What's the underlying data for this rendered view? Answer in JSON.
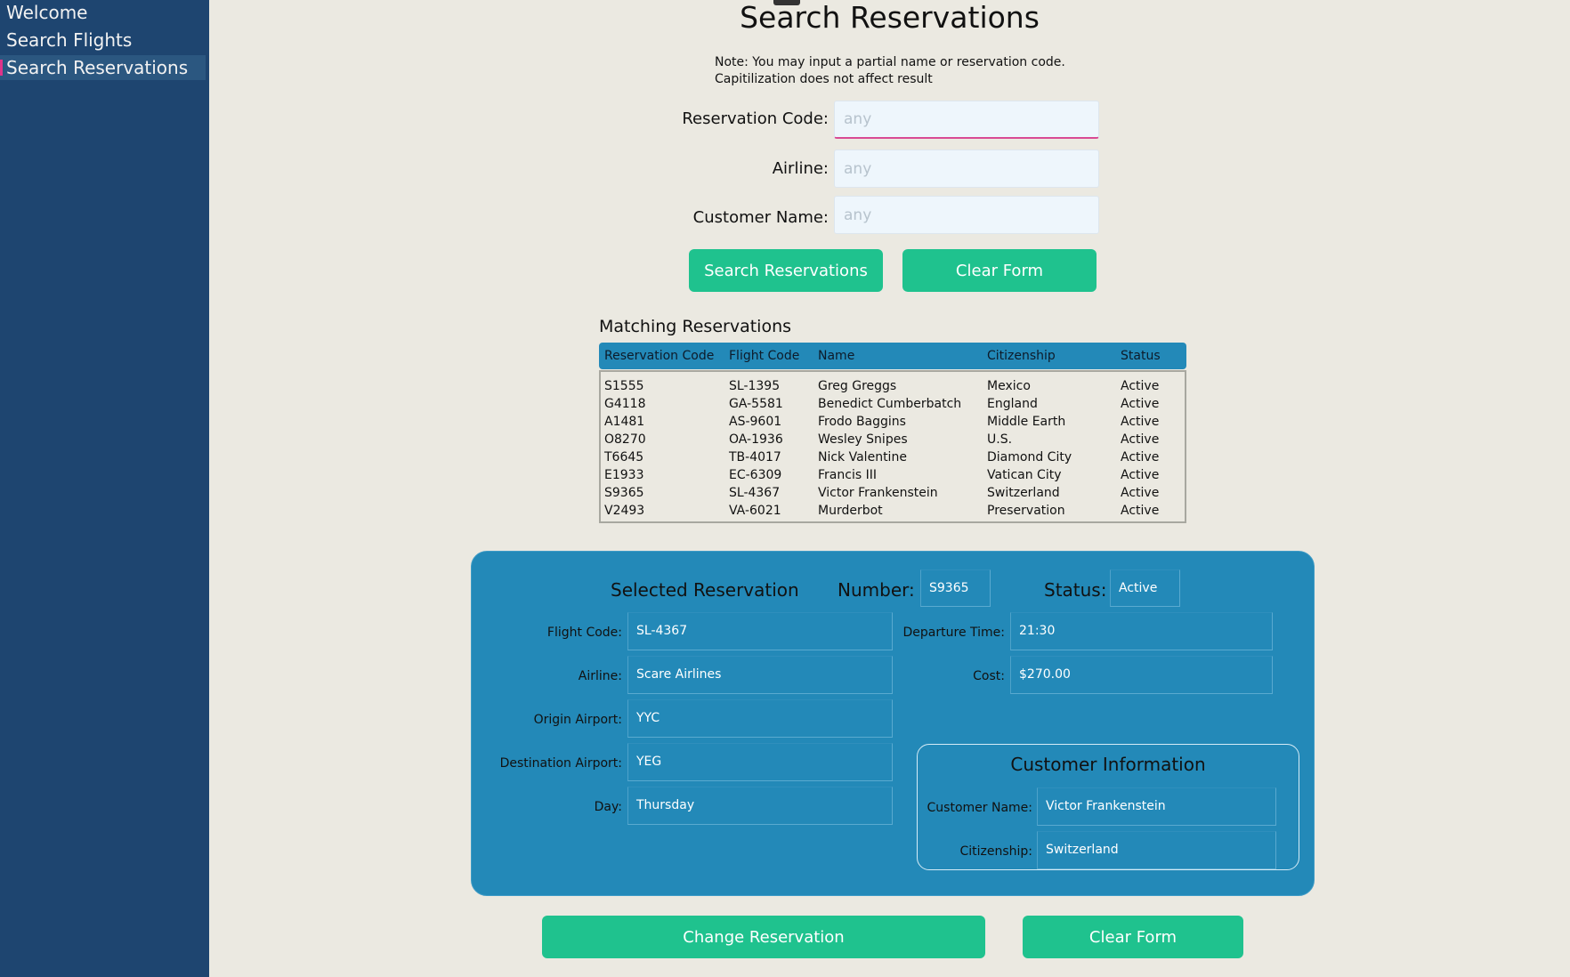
{
  "sidebar": {
    "items": [
      {
        "label": "Welcome"
      },
      {
        "label": "Search Flights"
      },
      {
        "label": "Search Reservations"
      }
    ]
  },
  "page": {
    "title": "Search Reservations",
    "note_line1": "Note: You may input a partial name or reservation code.",
    "note_line2": "Capitilization does not affect result"
  },
  "search_form": {
    "reservation_code_label": "Reservation Code:",
    "airline_label": "Airline:",
    "customer_name_label": "Customer Name:",
    "placeholder": "any",
    "search_button": "Search Reservations",
    "clear_button": "Clear Form"
  },
  "results": {
    "title": "Matching Reservations",
    "columns": [
      "Reservation Code",
      "Flight Code",
      "Name",
      "Citizenship",
      "Status"
    ],
    "rows": [
      [
        "S1555",
        "SL-1395",
        "Greg Greggs",
        "Mexico",
        "Active"
      ],
      [
        "G4118",
        "GA-5581",
        "Benedict Cumberbatch",
        "England",
        "Active"
      ],
      [
        "A1481",
        "AS-9601",
        "Frodo Baggins",
        "Middle Earth",
        "Active"
      ],
      [
        "O8270",
        "OA-1936",
        "Wesley Snipes",
        "U.S.",
        "Active"
      ],
      [
        "T6645",
        "TB-4017",
        "Nick Valentine",
        "Diamond City",
        "Active"
      ],
      [
        "E1933",
        "EC-6309",
        "Francis III",
        "Vatican City",
        "Active"
      ],
      [
        "S9365",
        "SL-4367",
        "Victor Frankenstein",
        "Switzerland",
        "Active"
      ],
      [
        "V2493",
        "VA-6021",
        "Murderbot",
        "Preservation",
        "Active"
      ]
    ]
  },
  "selected": {
    "heading": "Selected Reservation",
    "number_label": "Number:",
    "number_value": "S9365",
    "status_label": "Status:",
    "status_value": "Active",
    "flight_code_label": "Flight Code:",
    "flight_code_value": "SL-4367",
    "airline_label": "Airline:",
    "airline_value": "Scare Airlines",
    "origin_label": "Origin Airport:",
    "origin_value": "YYC",
    "destination_label": "Destination Airport:",
    "destination_value": "YEG",
    "day_label": "Day:",
    "day_value": "Thursday",
    "departure_label": "Departure Time:",
    "departure_value": "21:30",
    "cost_label": "Cost:",
    "cost_value": "$270.00",
    "customer_heading": "Customer Information",
    "customer_name_label": "Customer Name:",
    "customer_name_value": "Victor Frankenstein",
    "citizenship_label": "Citizenship:",
    "citizenship_value": "Switzerland"
  },
  "actions": {
    "change_button": "Change Reservation",
    "clear_button": "Clear Form"
  },
  "colors": {
    "sidebar": "#1e4570",
    "accent_green": "#1fc28e",
    "panel_blue": "#2389b8",
    "focus_pink": "#e0338a"
  }
}
